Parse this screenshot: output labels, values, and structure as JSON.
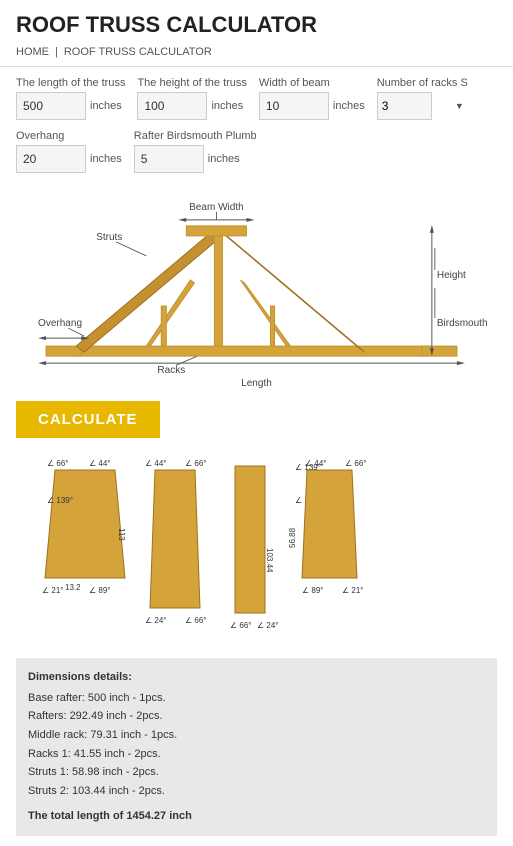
{
  "header": {
    "title": "ROOF TRUSS CALCULATOR"
  },
  "breadcrumb": {
    "home": "HOME",
    "separator": "|",
    "current": "ROOF TRUSS CALCULATOR"
  },
  "fields": {
    "truss_length_label": "The length of the truss",
    "truss_length_value": "500",
    "truss_length_unit": "inches",
    "truss_height_label": "The height of the truss",
    "truss_height_value": "100",
    "truss_height_unit": "inches",
    "beam_width_label": "Width of beam",
    "beam_width_value": "10",
    "beam_width_unit": "inches",
    "num_racks_label": "Number of racks S",
    "num_racks_value": "3",
    "overhang_label": "Overhang",
    "overhang_value": "20",
    "overhang_unit": "inches",
    "rafter_label": "Rafter Birdsmouth Plumb",
    "rafter_value": "5",
    "rafter_unit": "inches"
  },
  "calculate_btn": "CALCULATE",
  "diagram": {
    "beam_width_label": "Beam Width",
    "struts_label": "Struts",
    "height_label": "Height",
    "birdsmouth_label": "Birdsmouth",
    "overhang_label": "Overhang",
    "racks_label": "Racks",
    "length_label": "Length"
  },
  "results": {
    "title": "Dimensions details:",
    "lines": [
      "Base rafter: 500 inch - 1pcs.",
      "Rafters: 292.49 inch - 2pcs.",
      "Middle rack: 79.31 inch - 1pcs.",
      "Racks 1: 41.55 inch - 2pcs.",
      "Struts 1: 58.98 inch - 2pcs.",
      "Struts 2: 103.44 inch - 2pcs."
    ],
    "total": "The total length of 1454.27 inch"
  },
  "pieces": [
    {
      "id": "base",
      "angle_top_left": "66°",
      "angle_top_right": "44°",
      "angle_top_left2": "44°",
      "angle_top_right2": "66°",
      "label": "113",
      "bottom_left": "21°",
      "bottom_right": "89°",
      "bottom_left2": "24°",
      "bottom_right2": "66°"
    }
  ],
  "colors": {
    "gold": "#e8b800",
    "piece_fill": "#d4a43a",
    "piece_stroke": "#c49030"
  }
}
